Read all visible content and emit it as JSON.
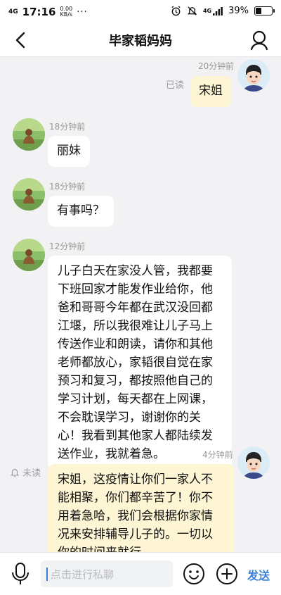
{
  "status_bar": {
    "network": "4G",
    "time": "17:16",
    "speed_value": "0.00",
    "speed_unit": "KB/s",
    "dots": "···",
    "signal_label": "4G",
    "battery": "39%"
  },
  "header": {
    "title": "毕家韬妈妈"
  },
  "messages": [
    {
      "side": "right",
      "time": "20分钟前",
      "status": "已读",
      "text": "宋姐"
    },
    {
      "side": "left",
      "time": "18分钟前",
      "text": "丽妹"
    },
    {
      "side": "left",
      "time": "18分钟前",
      "text": "有事吗？"
    },
    {
      "side": "left",
      "time": "12分钟前",
      "lines": [
        "儿子白天在家没人管，我都要",
        "下班回家才能发作业给你，他",
        "爸和哥哥今年都在武汉没回都",
        "江堰，所以我很难让儿子马上",
        "传送作业和朗读，请你和其他",
        "老师都放心，家韬很自觉在家",
        "预习和复习，都按照他自己的",
        "学习计划，每天都在上网课，",
        "不会耽误学习，谢谢你的关",
        "心！我看到其他家人都陆续发",
        "送作业，我就着急。"
      ]
    },
    {
      "side": "right",
      "time": "4分钟前",
      "status": "未读",
      "lines": [
        "宋姐，这疫情让你们一家人不",
        "能相聚，你们都辛苦了！你不",
        "用着急哈，我们会根据你家情",
        "况来安排辅导儿子的。一切以",
        "你的时间来就行。"
      ]
    }
  ],
  "input_bar": {
    "placeholder": "点击进行私聊",
    "send_label": "发送"
  },
  "colors": {
    "accent": "#3b82d6",
    "own_bubble": "#fdf5d3",
    "other_bubble": "#ffffff",
    "background": "#f2f2f4"
  }
}
